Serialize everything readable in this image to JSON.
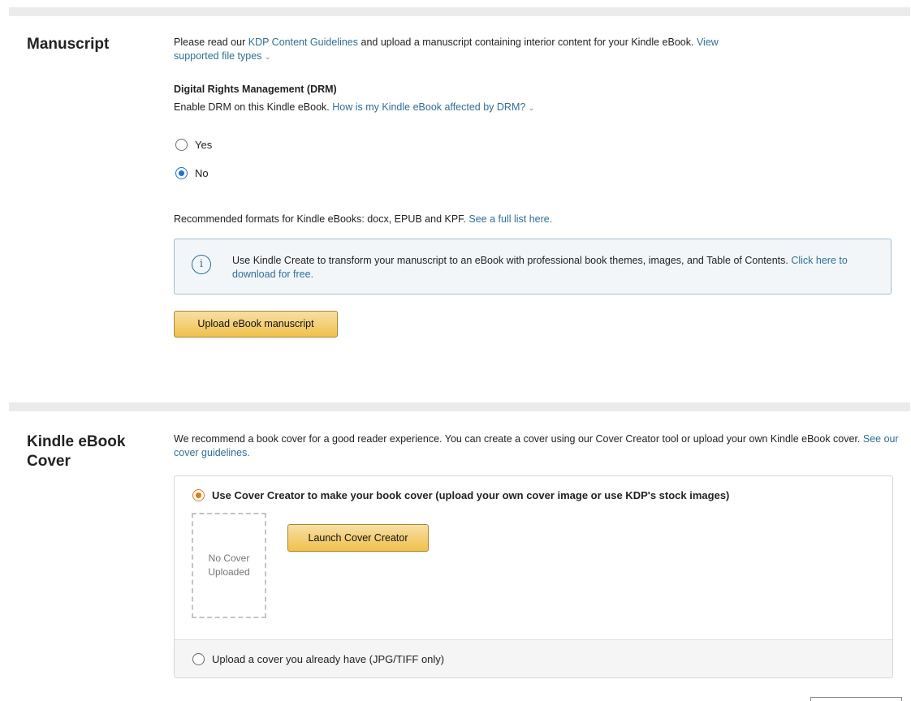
{
  "manuscript": {
    "title": "Manuscript",
    "intro_pre": "Please read our ",
    "guidelines_link": "KDP Content Guidelines",
    "intro_mid": " and upload a manuscript containing interior content for your Kindle eBook. ",
    "view_link_line1": "View",
    "view_link_line2": "supported file types",
    "drm_heading": "Digital Rights Management (DRM)",
    "drm_text": "Enable DRM on this Kindle eBook. ",
    "drm_link": "How is my Kindle eBook affected by DRM?",
    "options": [
      {
        "label": "Yes",
        "selected": false
      },
      {
        "label": "No",
        "selected": true
      }
    ],
    "formats_text": "Recommended formats for Kindle eBooks: docx, EPUB and KPF. ",
    "formats_link": "See a full list here.",
    "info_text": "Use Kindle Create to transform your manuscript to an eBook with professional book themes, images, and Table of Contents. ",
    "info_link": "Click here to download for free.",
    "upload_button": "Upload eBook manuscript"
  },
  "cover": {
    "title_line1": "Kindle eBook",
    "title_line2": "Cover",
    "intro": "We recommend a book cover for a good reader experience. You can create a cover using our Cover Creator tool or upload your own Kindle eBook cover. ",
    "guidelines_link": "See our cover guidelines.",
    "option_creator": "Use Cover Creator to make your book cover (upload your own cover image or use KDP's stock images)",
    "placeholder_line1": "No Cover",
    "placeholder_line2": "Uploaded",
    "launch_button": "Launch Cover Creator",
    "option_upload": "Upload a cover you already have (JPG/TIFF only)",
    "selected_option": "creator"
  },
  "colors": {
    "link": "#2f6f9a",
    "button": "#f0c14b",
    "radio_blue": "#1f6fd6",
    "radio_orange": "#e47911"
  }
}
